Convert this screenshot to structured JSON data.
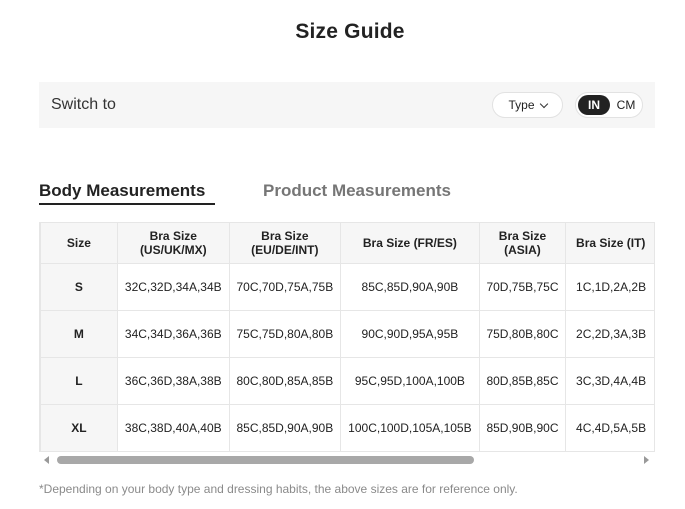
{
  "title": "Size Guide",
  "switch": {
    "label": "Switch to",
    "type_label": "Type",
    "unit_in": "IN",
    "unit_cm": "CM",
    "selected_unit": "IN"
  },
  "tabs": {
    "body": "Body Measurements",
    "product": "Product Measurements",
    "active": "body"
  },
  "table": {
    "headers": {
      "size": "Size",
      "us_l1": "Bra Size",
      "us_l2": "(US/UK/MX)",
      "eu_l1": "Bra Size",
      "eu_l2": "(EU/DE/INT)",
      "fr": "Bra Size (FR/ES)",
      "asia_l1": "Bra Size",
      "asia_l2": "(ASIA)",
      "it": "Bra Size (IT)"
    },
    "rows": [
      {
        "size": "S",
        "us": "32C,32D,34A,34B",
        "eu": "70C,70D,75A,75B",
        "fr": "85C,85D,90A,90B",
        "asia": "70D,75B,75C",
        "it": "1C,1D,2A,2B"
      },
      {
        "size": "M",
        "us": "34C,34D,36A,36B",
        "eu": "75C,75D,80A,80B",
        "fr": "90C,90D,95A,95B",
        "asia": "75D,80B,80C",
        "it": "2C,2D,3A,3B"
      },
      {
        "size": "L",
        "us": "36C,36D,38A,38B",
        "eu": "80C,80D,85A,85B",
        "fr": "95C,95D,100A,100B",
        "asia": "80D,85B,85C",
        "it": "3C,3D,4A,4B"
      },
      {
        "size": "XL",
        "us": "38C,38D,40A,40B",
        "eu": "85C,85D,90A,90B",
        "fr": "100C,100D,105A,105B",
        "asia": "85D,90B,90C",
        "it": "4C,4D,5A,5B"
      }
    ]
  },
  "footnote": "*Depending on your body type and dressing habits, the above sizes are for reference only."
}
